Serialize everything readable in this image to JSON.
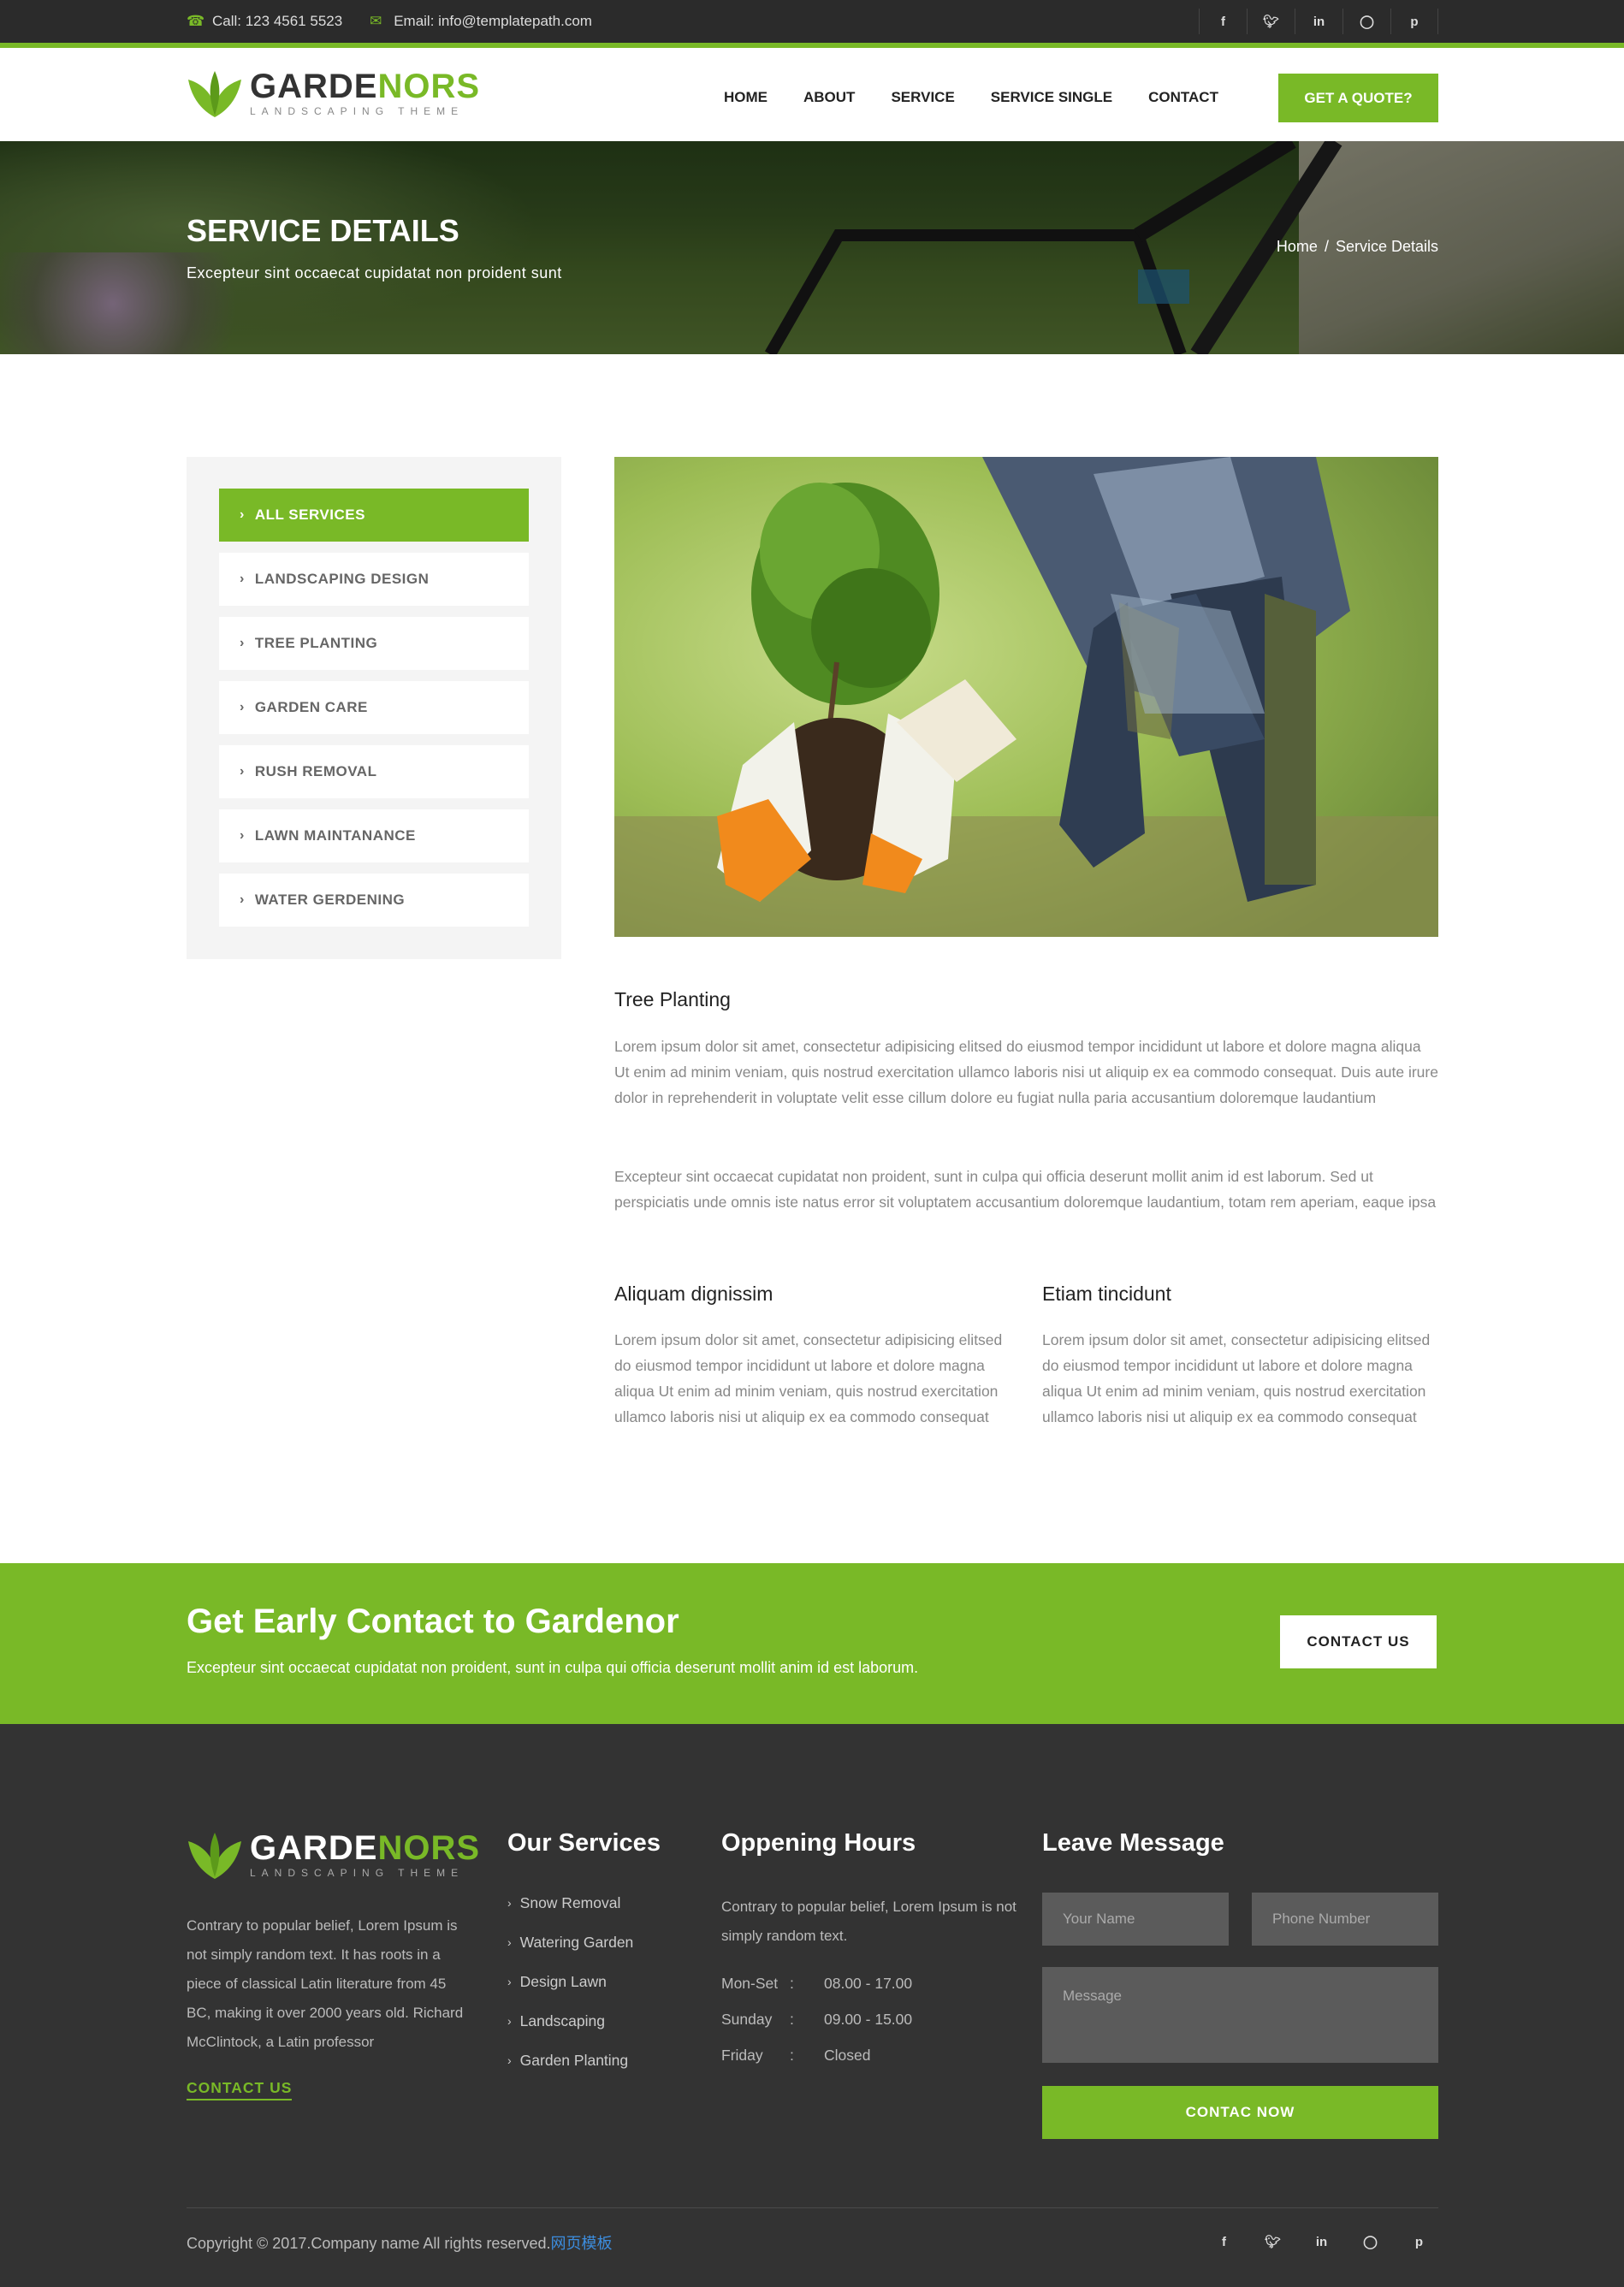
{
  "topbar": {
    "phone": "Call: 123 4561 5523",
    "email": "Email: info@templatepath.com",
    "social": [
      "f",
      "t",
      "in",
      "ig",
      "p"
    ]
  },
  "brand": {
    "name_part1": "GARDE",
    "name_part2": "NORS",
    "tagline": "LANDSCAPING THEME"
  },
  "nav": {
    "items": [
      "HOME",
      "ABOUT",
      "SERVICE",
      "SERVICE SINGLE",
      "CONTACT"
    ],
    "quote_label": "GET A QUOTE?"
  },
  "banner": {
    "title": "SERVICE DETAILS",
    "subtitle": "Excepteur sint occaecat cupidatat non proident sunt",
    "breadcrumb": [
      "Home",
      "/",
      "Service Details"
    ]
  },
  "sidebar": {
    "items": [
      {
        "label": "ALL SERVICES",
        "active": true
      },
      {
        "label": "LANDSCAPING DESIGN",
        "active": false
      },
      {
        "label": "TREE PLANTING",
        "active": false
      },
      {
        "label": "GARDEN CARE",
        "active": false
      },
      {
        "label": "RUSH REMOVAL",
        "active": false
      },
      {
        "label": "LAWN MAINTANANCE",
        "active": false
      },
      {
        "label": "WATER GERDENING",
        "active": false
      }
    ]
  },
  "main": {
    "heading": "Tree Planting",
    "para1": "Lorem ipsum dolor sit amet, consectetur adipisicing elitsed do eiusmod tempor incididunt ut labore et dolore magna aliqua Ut enim ad minim veniam, quis nostrud exercitation ullamco laboris nisi ut aliquip ex ea commodo consequat. Duis aute irure dolor in reprehenderit in voluptate velit esse cillum dolore eu fugiat nulla paria accusantium doloremque laudantium",
    "para2": "Excepteur sint occaecat cupidatat non proident, sunt in culpa qui officia deserunt mollit anim id est laborum. Sed ut perspiciatis unde omnis iste natus error sit voluptatem accusantium doloremque laudantium, totam rem aperiam, eaque ipsa",
    "col1_heading": "Aliquam dignissim",
    "col1_text": "Lorem ipsum dolor sit amet, consectetur adipisicing elitsed do eiusmod tempor incididunt ut labore et dolore magna aliqua Ut enim ad minim veniam, quis nostrud exercitation ullamco laboris nisi ut aliquip ex ea commodo consequat",
    "col2_heading": "Etiam tincidunt",
    "col2_text": "Lorem ipsum dolor sit amet, consectetur adipisicing elitsed do eiusmod tempor incididunt ut labore et dolore magna aliqua Ut enim ad minim veniam, quis nostrud exercitation ullamco laboris nisi ut aliquip ex ea commodo consequat"
  },
  "cta": {
    "heading": "Get Early Contact to Gardenor",
    "text": "Excepteur sint occaecat cupidatat non proident, sunt in culpa qui officia deserunt mollit anim id est laborum.",
    "button": "CONTACT US"
  },
  "footer": {
    "about_text": "Contrary to popular belief, Lorem Ipsum is not simply random text. It has roots in a piece of classical Latin literature from 45 BC, making it over 2000 years old. Richard McClintock, a Latin professor",
    "contact_link": "CONTACT US",
    "services_heading": "Our Services",
    "services": [
      "Snow Removal",
      "Watering Garden",
      "Design Lawn",
      "Landscaping",
      "Garden Planting"
    ],
    "hours_heading": "Oppening Hours",
    "hours_text": "Contrary to popular belief, Lorem Ipsum is not simply random text.",
    "hours": [
      {
        "day": "Mon-Set",
        "sep": ":",
        "time": "08.00 - 17.00"
      },
      {
        "day": "Sunday",
        "sep": ":",
        "time": "09.00 - 15.00"
      },
      {
        "day": "Friday",
        "sep": ":",
        "time": "Closed"
      }
    ],
    "message_heading": "Leave Message",
    "name_placeholder": "Your Name",
    "phone_placeholder": "Phone Number",
    "message_placeholder": "Message",
    "send_label": "CONTAC NOW",
    "copyright": "Copyright © 2017.Company name All rights reserved.",
    "copyright_link": "网页模板"
  },
  "colors": {
    "accent": "#79b927",
    "dark": "#2b2b2b",
    "footer": "#333333"
  }
}
